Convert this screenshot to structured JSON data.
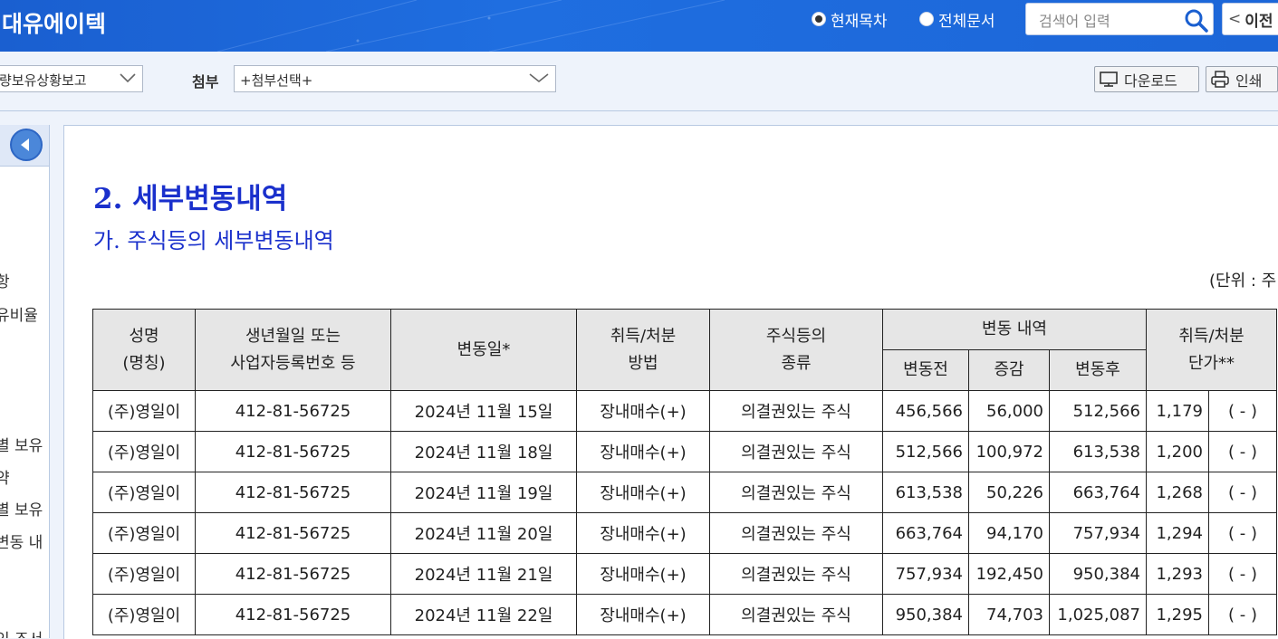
{
  "header": {
    "brand": "대유에이텍",
    "radio_current": "현재목차",
    "radio_all": "전체문서",
    "search_placeholder": "검색어 입력",
    "prev_label": "이전"
  },
  "toolbar": {
    "report_select_value": "량보유상황보고",
    "attach_label": "첨부",
    "attach_select_value": "+첨부선택+",
    "download_label": "다운로드",
    "print_label": "인쇄"
  },
  "toc": {
    "items": [
      "항",
      "유비율",
      "별 보유",
      "약",
      "별 보유",
      "변동 내",
      "인 조서"
    ]
  },
  "doc": {
    "heading": "2. 세부변동내역",
    "subheading": "가. 주식등의 세부변동내역",
    "unit_note": "(단위 : 주"
  },
  "table": {
    "headers": {
      "name_l1": "성명",
      "name_l2": "(명칭)",
      "id_l1": "생년월일 또는",
      "id_l2": "사업자등록번호 등",
      "date": "변동일*",
      "method_l1": "취득/처분",
      "method_l2": "방법",
      "type_l1": "주식등의",
      "type_l2": "종류",
      "change_group": "변동 내역",
      "before": "변동전",
      "delta": "증감",
      "after": "변동후",
      "price_l1": "취득/처분",
      "price_l2": "단가**"
    },
    "rows": [
      {
        "name": "(주)영일이",
        "id": "412-81-56725",
        "date": "2024년 11월 15일",
        "method": "장내매수(+)",
        "type": "의결권있는 주식",
        "before": "456,566",
        "delta": "56,000",
        "after": "512,566",
        "price": "1,179",
        "note": "( - )"
      },
      {
        "name": "(주)영일이",
        "id": "412-81-56725",
        "date": "2024년 11월 18일",
        "method": "장내매수(+)",
        "type": "의결권있는 주식",
        "before": "512,566",
        "delta": "100,972",
        "after": "613,538",
        "price": "1,200",
        "note": "( - )"
      },
      {
        "name": "(주)영일이",
        "id": "412-81-56725",
        "date": "2024년 11월 19일",
        "method": "장내매수(+)",
        "type": "의결권있는 주식",
        "before": "613,538",
        "delta": "50,226",
        "after": "663,764",
        "price": "1,268",
        "note": "( - )"
      },
      {
        "name": "(주)영일이",
        "id": "412-81-56725",
        "date": "2024년 11월 20일",
        "method": "장내매수(+)",
        "type": "의결권있는 주식",
        "before": "663,764",
        "delta": "94,170",
        "after": "757,934",
        "price": "1,294",
        "note": "( - )"
      },
      {
        "name": "(주)영일이",
        "id": "412-81-56725",
        "date": "2024년 11월 21일",
        "method": "장내매수(+)",
        "type": "의결권있는 주식",
        "before": "757,934",
        "delta": "192,450",
        "after": "950,384",
        "price": "1,293",
        "note": "( - )"
      },
      {
        "name": "(주)영일이",
        "id": "412-81-56725",
        "date": "2024년 11월 22일",
        "method": "장내매수(+)",
        "type": "의결권있는 주식",
        "before": "950,384",
        "delta": "74,703",
        "after": "1,025,087",
        "price": "1,295",
        "note": "( - )"
      }
    ]
  }
}
